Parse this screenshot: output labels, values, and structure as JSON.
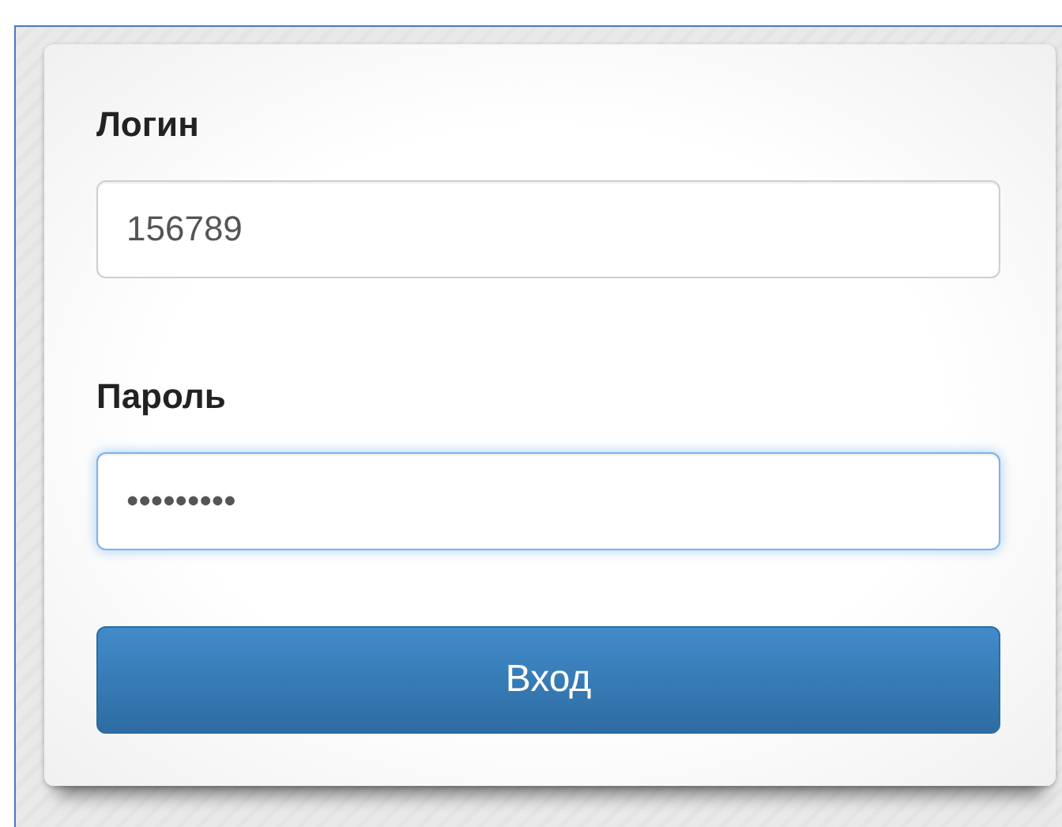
{
  "form": {
    "fields": [
      {
        "label": "Логин",
        "value": "156789",
        "focused": false
      },
      {
        "label": "Пароль",
        "value": "•••••••••",
        "focused": true
      }
    ],
    "button": "Вход"
  }
}
